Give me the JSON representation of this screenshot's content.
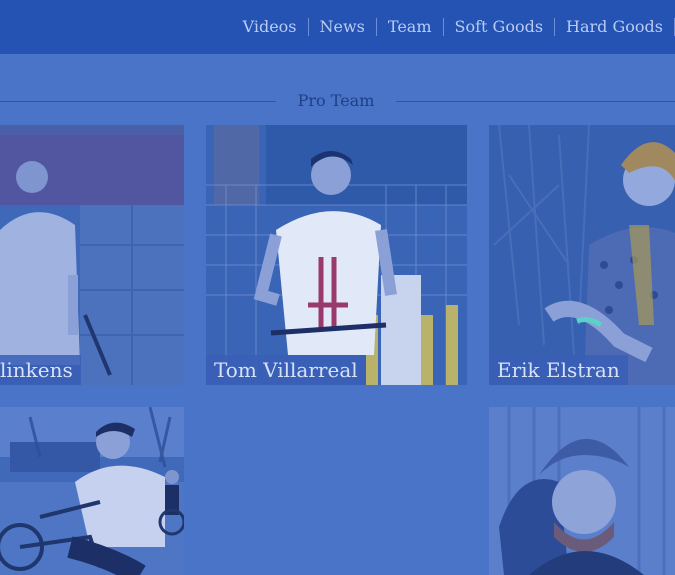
{
  "nav": {
    "items": [
      {
        "label": "Videos"
      },
      {
        "label": "News"
      },
      {
        "label": "Team"
      },
      {
        "label": "Soft Goods"
      },
      {
        "label": "Hard Goods"
      }
    ]
  },
  "section": {
    "title": "Pro Team"
  },
  "team": {
    "riders": [
      {
        "name": "linkens"
      },
      {
        "name": "Tom Villarreal"
      },
      {
        "name": "Erik Elstran"
      },
      {
        "name": ""
      },
      {
        "name": ""
      }
    ]
  },
  "colors": {
    "page_bg": "#4a74c8",
    "navbar_bg": "#2453b4",
    "nav_text": "#b9cbf2",
    "title_text": "#1f3f86"
  }
}
